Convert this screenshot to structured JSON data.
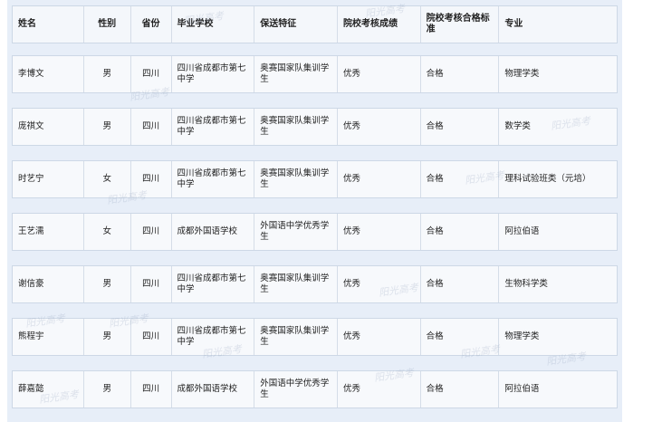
{
  "headers": [
    "姓名",
    "性别",
    "省份",
    "毕业学校",
    "保送特征",
    "院校考核成绩",
    "院校考核合格标准",
    "专业"
  ],
  "rows": [
    [
      "李博文",
      "男",
      "四川",
      "四川省成都市第七中学",
      "奥赛国家队集训学生",
      "优秀",
      "合格",
      "物理学类"
    ],
    [
      "庞祺文",
      "男",
      "四川",
      "四川省成都市第七中学",
      "奥赛国家队集训学生",
      "优秀",
      "合格",
      "数学类"
    ],
    [
      "时艺宁",
      "女",
      "四川",
      "四川省成都市第七中学",
      "奥赛国家队集训学生",
      "优秀",
      "合格",
      "理科试验班类（元培）"
    ],
    [
      "王艺濡",
      "女",
      "四川",
      "成都外国语学校",
      "外国语中学优秀学生",
      "优秀",
      "合格",
      "阿拉伯语"
    ],
    [
      "谢信豪",
      "男",
      "四川",
      "四川省成都市第七中学",
      "奥赛国家队集训学生",
      "优秀",
      "合格",
      "生物科学类"
    ],
    [
      "熊程宇",
      "男",
      "四川",
      "四川省成都市第七中学",
      "奥赛国家队集训学生",
      "优秀",
      "合格",
      "物理学类"
    ],
    [
      "薛嘉懿",
      "男",
      "四川",
      "成都外国语学校",
      "外国语中学优秀学生",
      "优秀",
      "合格",
      "阿拉伯语"
    ]
  ],
  "watermark": "阳光高考"
}
